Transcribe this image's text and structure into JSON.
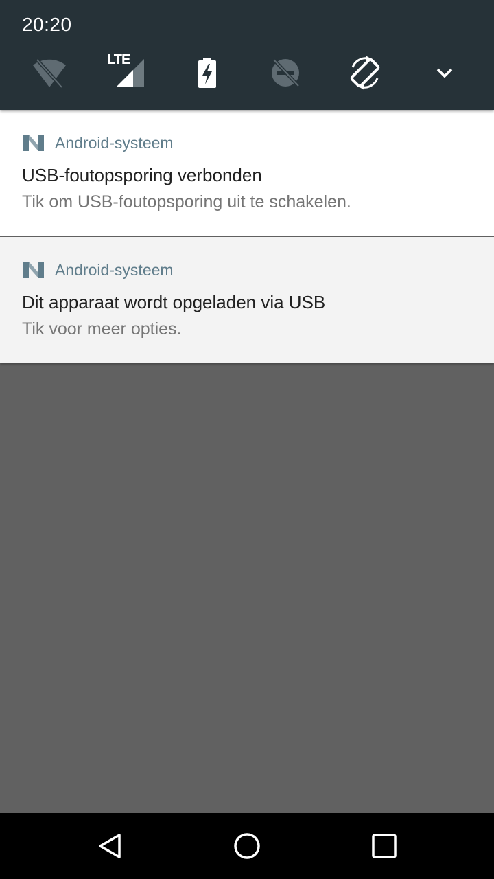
{
  "status": {
    "time": "20:20"
  },
  "quick_settings": {
    "tiles": [
      {
        "icon": "wifi-off-icon",
        "state": "off"
      },
      {
        "icon": "lte-signal-icon",
        "label": "LTE"
      },
      {
        "icon": "battery-charging-icon"
      },
      {
        "icon": "do-not-disturb-off-icon",
        "state": "off"
      },
      {
        "icon": "auto-rotate-icon",
        "state": "on"
      },
      {
        "icon": "expand-chevron-icon"
      }
    ]
  },
  "notifications": [
    {
      "app_name": "Android-systeem",
      "title": "USB-foutopsporing verbonden",
      "text": "Tik om USB-foutopsporing uit te schakelen."
    },
    {
      "app_name": "Android-systeem",
      "title": "Dit apparaat wordt opgeladen via USB",
      "text": "Tik voor meer opties."
    }
  ],
  "navbar": {
    "buttons": [
      "back-icon",
      "home-icon",
      "recents-icon"
    ]
  },
  "colors": {
    "header_bg": "#263238",
    "app_name": "#607d8b",
    "scrim": "#616161"
  }
}
